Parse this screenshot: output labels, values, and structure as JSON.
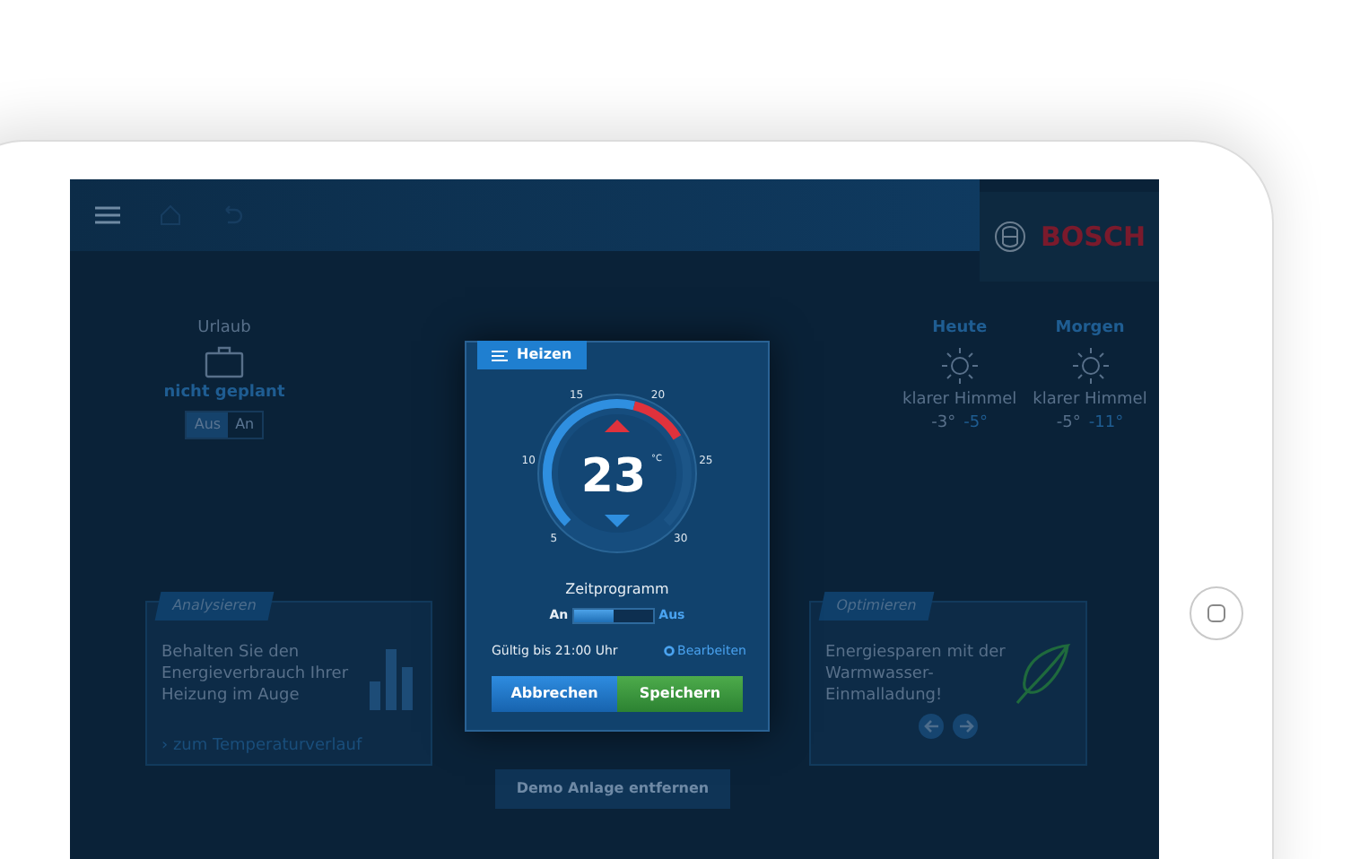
{
  "logo": {
    "text": "BOSCH"
  },
  "vacation": {
    "title": "Urlaub",
    "status": "nicht geplant",
    "toggle": [
      {
        "label": "Aus",
        "selected": true
      },
      {
        "label": "An",
        "selected": false
      }
    ]
  },
  "weather": [
    {
      "day": "Heute",
      "condition": "klarer Himmel",
      "high": "-3°",
      "low": "-5°"
    },
    {
      "day": "Morgen",
      "condition": "klarer Himmel",
      "high": "-5°",
      "low": "-11°"
    }
  ],
  "cards": [
    {
      "kind": "analyze",
      "title": "Analysieren",
      "text": "Behalten Sie den Energieverbrauch Ihrer Heizung im Auge",
      "link": "› zum Temperaturverlauf"
    },
    {
      "kind": "optimize",
      "title": "Optimieren",
      "text": "Energiesparen mit der Warmwasser-Einmalladung!"
    }
  ],
  "demo_button": "Demo Anlage entfernen",
  "dialog": {
    "title": "Heizen",
    "scale": [
      "5",
      "10",
      "15",
      "20",
      "25",
      "30"
    ],
    "temperature": "23",
    "unit": "°C",
    "schedule_label": "Zeitprogramm",
    "schedule_on_label": "An",
    "schedule_off_label": "Aus",
    "schedule_on": true,
    "valid_until": "Gültig bis 21:00 Uhr",
    "edit_link": "Bearbeiten",
    "cancel": "Abbrechen",
    "save": "Speichern"
  }
}
